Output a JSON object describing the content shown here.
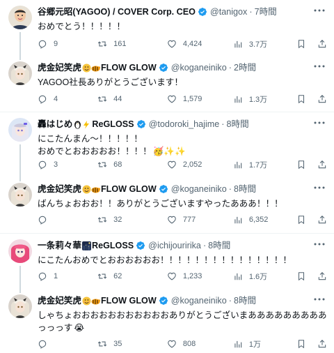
{
  "tweets": [
    {
      "name": "谷郷元昭(YAGOO) / COVER Corp. CEO",
      "name_emoji": "",
      "name_suffix": "",
      "handle": "@tanigox",
      "time": "7時間",
      "lines": [
        "おめでとう！！！！！"
      ],
      "replies": "9",
      "retweets": "161",
      "likes": "4,424",
      "views": "3.7万"
    },
    {
      "name": "虎金妃笑虎",
      "name_emoji": "smiling-face-and-tiger-emoji",
      "name_suffix": "FLOW GLOW",
      "handle": "@koganeiniko",
      "time": "2時間",
      "lines": [
        "YAGOO社長ありがとうございます！"
      ],
      "replies": "4",
      "retweets": "44",
      "likes": "1,579",
      "views": "1.3万"
    },
    {
      "name": "轟はじめ",
      "name_emoji": "penguin-and-lightning-emoji",
      "name_suffix": "ReGLOSS",
      "handle": "@todoroki_hajime",
      "time": "8時間",
      "lines": [
        "にこたんまん～！！！！！",
        "おめでとおおおおお！！！！"
      ],
      "replies": "3",
      "retweets": "68",
      "likes": "2,052",
      "views": "1.7万"
    },
    {
      "name": "虎金妃笑虎",
      "name_emoji": "smiling-face-and-tiger-emoji",
      "name_suffix": "FLOW GLOW",
      "handle": "@koganeiniko",
      "time": "8時間",
      "lines": [
        "ばんちょおおお！！ありがとうございますやったあああ！！！"
      ],
      "replies": "",
      "retweets": "32",
      "likes": "777",
      "views": "6,352"
    },
    {
      "name": "一条莉々華",
      "name_emoji": "night-city-emoji",
      "name_suffix": "ReGLOSS",
      "handle": "@ichijouririka",
      "time": "8時間",
      "lines": [
        "にこたんおめでとおおおおおお！！！！！！！！！！！！！！！"
      ],
      "replies": "1",
      "retweets": "62",
      "likes": "1,233",
      "views": "1.6万"
    },
    {
      "name": "虎金妃笑虎",
      "name_emoji": "smiling-face-and-tiger-emoji",
      "name_suffix": "FLOW GLOW",
      "handle": "@koganeiniko",
      "time": "8時間",
      "lines": [
        "しゃちょおおおおおおおおおおおありがとうございまあああああああああ",
        "っっっす"
      ],
      "replies": "",
      "retweets": "35",
      "likes": "808",
      "views": "1万"
    }
  ],
  "colors": {
    "text": "#0f1419",
    "muted": "#536471",
    "verified": "#1d9bf0",
    "divider": "#eff3f4",
    "thread": "#cfd9de"
  }
}
